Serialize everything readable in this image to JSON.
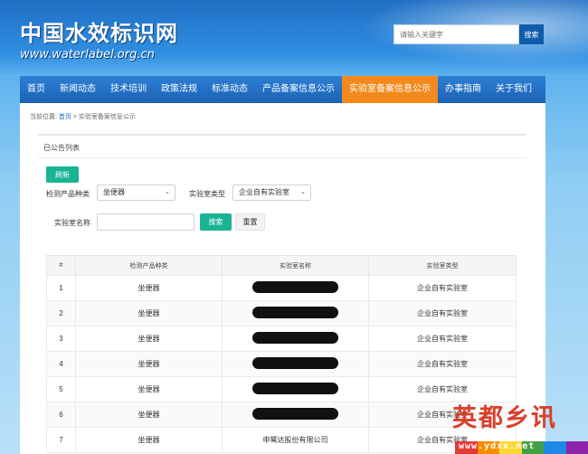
{
  "header": {
    "logo_cn": "中国水效标识网",
    "logo_url": "www.waterlabel.org.cn",
    "search_placeholder": "请输入关键字",
    "search_button": "搜索"
  },
  "nav": [
    {
      "label": "首页",
      "active": false
    },
    {
      "label": "新闻动态",
      "active": false
    },
    {
      "label": "技术培训",
      "active": false
    },
    {
      "label": "政策法规",
      "active": false
    },
    {
      "label": "标准动态",
      "active": false
    },
    {
      "label": "产品备案信息公示",
      "active": false
    },
    {
      "label": "实验室备案信息公示",
      "active": true
    },
    {
      "label": "办事指南",
      "active": false
    },
    {
      "label": "关于我们",
      "active": false
    }
  ],
  "breadcrumb": {
    "prefix": "当前位置:",
    "home": "首页",
    "sep": ">",
    "current": "实验室备案信息公示"
  },
  "panel": {
    "title": "已公告列表",
    "refresh_button": "刷新"
  },
  "filters": {
    "product_label": "检测产品种类",
    "product_value": "坐便器",
    "lab_type_label": "实验室类型",
    "lab_type_value": "企业自有实验室",
    "lab_name_label": "实验室名称",
    "lab_name_value": "",
    "search_button": "搜索",
    "reset_button": "重置"
  },
  "table": {
    "headers": [
      "#",
      "检测产品种类",
      "实验室名称",
      "实验室类型"
    ],
    "rows": [
      {
        "no": "1",
        "product": "坐便器",
        "name": "",
        "redacted": true,
        "type": "企业自有实验室"
      },
      {
        "no": "2",
        "product": "坐便器",
        "name": "",
        "redacted": true,
        "type": "企业自有实验室"
      },
      {
        "no": "3",
        "product": "坐便器",
        "name": "",
        "redacted": true,
        "type": "企业自有实验室"
      },
      {
        "no": "4",
        "product": "坐便器",
        "name": "",
        "redacted": true,
        "type": "企业自有实验室"
      },
      {
        "no": "5",
        "product": "坐便器",
        "name": "",
        "redacted": true,
        "type": "企业自有实验室"
      },
      {
        "no": "6",
        "product": "坐便器",
        "name": "",
        "redacted": true,
        "type": "企业自有实验室"
      },
      {
        "no": "7",
        "product": "坐便器",
        "name": "申鹭达股份有限公司",
        "redacted": false,
        "type": "企业自有实验室"
      }
    ]
  },
  "watermark": {
    "text": "英都乡讯",
    "url": "www.ydxx.net",
    "colors": [
      "#e53935",
      "#fb8c00",
      "#fdd835",
      "#43a047",
      "#1e88e5",
      "#8e24aa"
    ]
  }
}
